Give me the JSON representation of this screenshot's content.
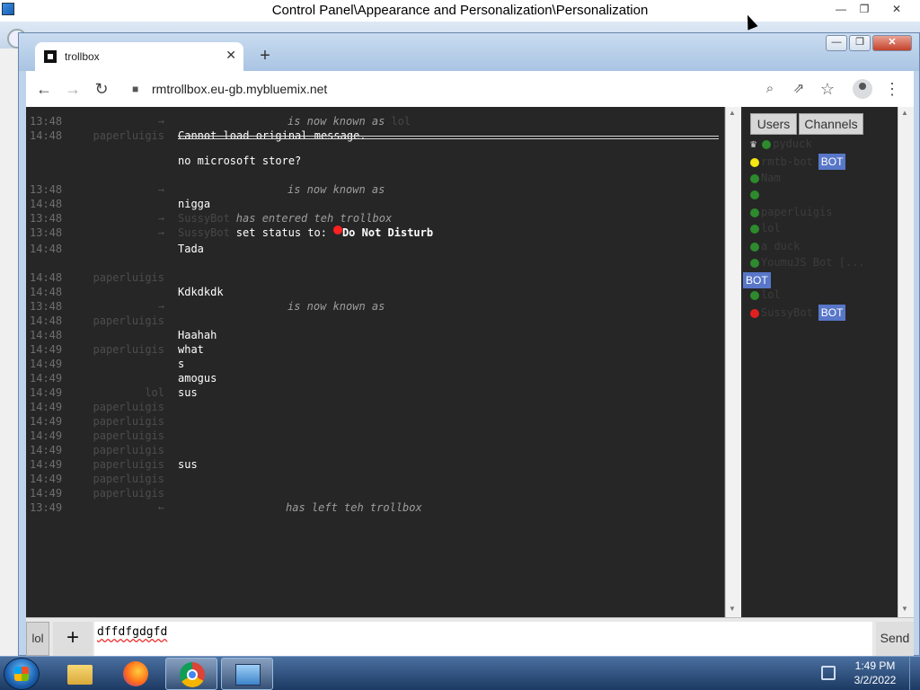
{
  "control_panel": {
    "title": "Control Panel\\Appearance and Personalization\\Personalization",
    "minimize_label": "—",
    "restore_label": "❐",
    "close_label": "✕"
  },
  "browser": {
    "tab_title": "trollbox",
    "tab_close_label": "✕",
    "new_tab_label": "+",
    "url": "rmtrollbox.eu-gb.mybluemix.net",
    "window_min_label": "—",
    "window_restore_label": "❐",
    "window_close_label": "✕",
    "icons": {
      "back": "←",
      "forward": "→",
      "reload": "↻",
      "lock": "🔒",
      "zoom": "⌕",
      "share": "⇗",
      "star": "☆",
      "menu": "⋮"
    }
  },
  "chat": {
    "messages": [
      {
        "time": "13:48",
        "nick": "→",
        "kind": "sys",
        "sys_text": "is now known as",
        "sys_name_after": "lol"
      },
      {
        "time": "14:48",
        "nick": "paperluigis",
        "kind": "text",
        "text": "Cannot load original message."
      },
      {
        "kind": "divider"
      },
      {
        "time": "",
        "nick": "",
        "kind": "text",
        "text": "no microsoft store?"
      },
      {
        "time": "13:48",
        "nick": "→",
        "kind": "sys",
        "sys_text": "is now known as",
        "sys_name_after": ""
      },
      {
        "time": "14:48",
        "nick": "",
        "kind": "text",
        "text": "nigga"
      },
      {
        "time": "13:48",
        "nick": "→",
        "kind": "sys_entered",
        "sys_name": "SussyBot",
        "sys_text": "has entered teh trollbox"
      },
      {
        "time": "13:48",
        "nick": "→",
        "kind": "status",
        "sys_name": "SussyBot",
        "status_prefix": "set status to:",
        "status_value": "Do Not Disturb"
      },
      {
        "time": "14:48",
        "nick": "",
        "kind": "text",
        "text": "Tada"
      },
      {
        "time": "14:48",
        "nick": "paperluigis",
        "kind": "text",
        "text": ""
      },
      {
        "time": "14:48",
        "nick": "",
        "kind": "text",
        "text": "Kdkdkdk"
      },
      {
        "time": "13:48",
        "nick": "→",
        "kind": "sys",
        "sys_text": "is now known as",
        "sys_name_after": ""
      },
      {
        "time": "14:48",
        "nick": "paperluigis",
        "kind": "text",
        "text": ""
      },
      {
        "time": "14:48",
        "nick": "",
        "kind": "text",
        "text": "Haahah"
      },
      {
        "time": "14:49",
        "nick": "paperluigis",
        "kind": "text",
        "text": "what"
      },
      {
        "time": "14:49",
        "nick": "",
        "kind": "text",
        "text": "s"
      },
      {
        "time": "14:49",
        "nick": "",
        "kind": "text",
        "text": "amogus"
      },
      {
        "time": "14:49",
        "nick": "lol",
        "kind": "text",
        "text": "sus"
      },
      {
        "time": "14:49",
        "nick": "paperluigis",
        "kind": "text",
        "text": ""
      },
      {
        "time": "14:49",
        "nick": "paperluigis",
        "kind": "text",
        "text": ""
      },
      {
        "time": "14:49",
        "nick": "paperluigis",
        "kind": "text",
        "text": ""
      },
      {
        "time": "14:49",
        "nick": "paperluigis",
        "kind": "text",
        "text": ""
      },
      {
        "time": "14:49",
        "nick": "paperluigis",
        "kind": "text",
        "text": "sus"
      },
      {
        "time": "14:49",
        "nick": "paperluigis",
        "kind": "text",
        "text": ""
      },
      {
        "time": "14:49",
        "nick": "paperluigis",
        "kind": "text",
        "text": ""
      },
      {
        "time": "13:49",
        "nick": "←",
        "kind": "sys_left",
        "sys_text": "has left teh trollbox"
      }
    ]
  },
  "users_panel": {
    "tab_users": "Users",
    "tab_channels": "Channels",
    "users": [
      {
        "name": "pyduck",
        "dot": "#2d8a2d",
        "prefix": "♛",
        "bot": false
      },
      {
        "name": "rmtb-bot",
        "dot": "#f5e614",
        "bot": true
      },
      {
        "name": "Nam",
        "dot": "#2d8a2d",
        "bot": false
      },
      {
        "name": "",
        "dot": "#2d8a2d",
        "bot": false
      },
      {
        "name": "paperluigis",
        "dot": "#2d8a2d",
        "bot": false
      },
      {
        "name": "lol",
        "dot": "#2d8a2d",
        "bot": false
      },
      {
        "name": "a duck",
        "dot": "#2d8a2d",
        "bot": false
      },
      {
        "name": "YoumuJS Bot [...",
        "dot": "#2d8a2d",
        "bot": false
      },
      {
        "name": "",
        "dot": "",
        "bot": true,
        "badge_only": true
      },
      {
        "name": "lol",
        "dot": "#2d8a2d",
        "bot": false
      },
      {
        "name": "SussyBot",
        "dot": "#e02020",
        "bot": true
      }
    ],
    "bot_label": "BOT"
  },
  "input_bar": {
    "nick_label": "lol",
    "add_label": "+",
    "message_value": "dffdfgdgfd",
    "send_label": "Send"
  },
  "taskbar": {
    "time": "1:49 PM",
    "date": "3/2/2022",
    "apps": [
      "start-menu",
      "file-explorer",
      "firefox",
      "chrome",
      "control-panel"
    ]
  }
}
